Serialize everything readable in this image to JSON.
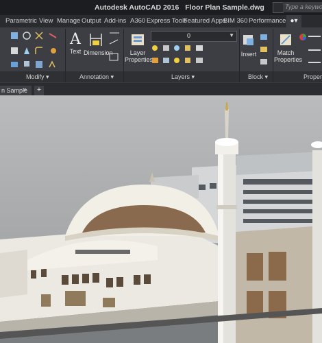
{
  "titlebar": {
    "app_title": "Autodesk AutoCAD 2016",
    "file_name": "Floor Plan Sample.dwg",
    "search_placeholder": "Type a keyword or"
  },
  "tabs": [
    "Parametric",
    "View",
    "Manage",
    "Output",
    "Add-ins",
    "A360",
    "Express Tools",
    "Featured Apps",
    "BIM 360",
    "Performance"
  ],
  "ribbon": {
    "panels": {
      "modify": "Modify",
      "annotation": "Annotation",
      "layers": "Layers",
      "block": "Block",
      "properties": "Propertie"
    },
    "buttons": {
      "text": "Text",
      "dimension": "Dimension",
      "layer_properties_1": "Layer",
      "layer_properties_2": "Properties",
      "insert": "Insert",
      "match_1": "Match",
      "match_2": "Properties"
    },
    "layer_value": "0"
  },
  "filetabs": {
    "active": "n Sample",
    "close": "×",
    "new": "+"
  },
  "colors": {
    "titlebar": "#1c1d20",
    "ribbon": "#3d3e43",
    "viewport_bg": "#aeb0b2"
  }
}
